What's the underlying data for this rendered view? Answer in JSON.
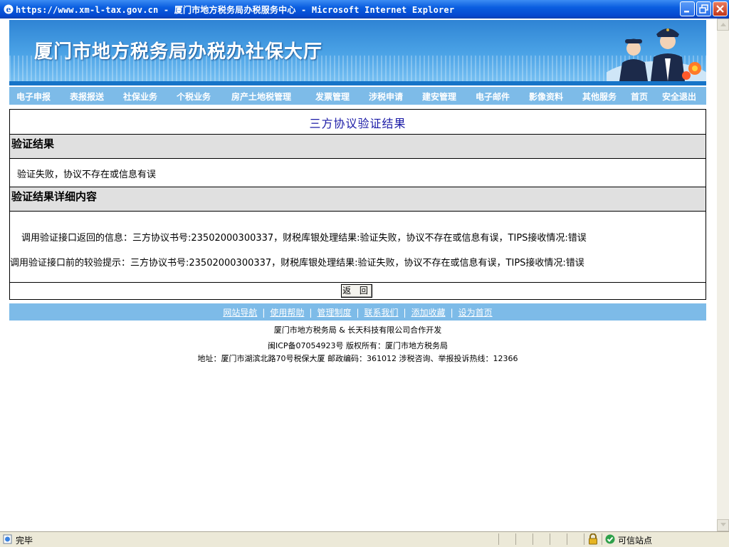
{
  "window": {
    "title": "https://www.xm-l-tax.gov.cn - 厦门市地方税务局办税服务中心 - Microsoft Internet Explorer"
  },
  "banner": {
    "title": "厦门市地方税务局办税办社保大厅"
  },
  "nav": {
    "items": [
      "电子申报",
      "表报报送",
      "社保业务",
      "个税业务",
      "房产土地税管理",
      "发票管理",
      "涉税申请",
      "建安管理",
      "电子邮件",
      "影像资料",
      "其他服务",
      "首页",
      "安全退出"
    ]
  },
  "panel": {
    "title": "三方协议验证结果",
    "result_header": "验证结果",
    "result_text": "验证失败，协议不存在或信息有误",
    "detail_header": "验证结果详细内容",
    "detail_line1": "调用验证接口返回的信息：三方协议书号:23502000300337，财税库银处理结果:验证失败，协议不存在或信息有误，TIPS接收情况:错误",
    "detail_line2": "调用验证接口前的较验提示：三方协议书号:23502000300337，财税库银处理结果:验证失败，协议不存在或信息有误，TIPS接收情况:错误",
    "return_label": "返 回"
  },
  "footer": {
    "links": [
      "网站导航",
      "使用帮助",
      "管理制度",
      "联系我们",
      "添加收藏",
      "设为首页"
    ],
    "separator": "|",
    "line1": "厦门市地方税务局 & 长天科技有限公司合作开发",
    "line2": "闽ICP备07054923号   版权所有：厦门市地方税务局",
    "line3": "地址：厦门市湖滨北路70号税保大厦      邮政编码：361012      涉税咨询、举报投诉热线：12366"
  },
  "statusbar": {
    "status": "完毕",
    "zone": "可信站点"
  },
  "icons": [
    "ie-icon",
    "minimize-icon",
    "maximize-icon",
    "close-icon",
    "lock-icon",
    "trusted-zone-icon",
    "done-page-icon"
  ]
}
